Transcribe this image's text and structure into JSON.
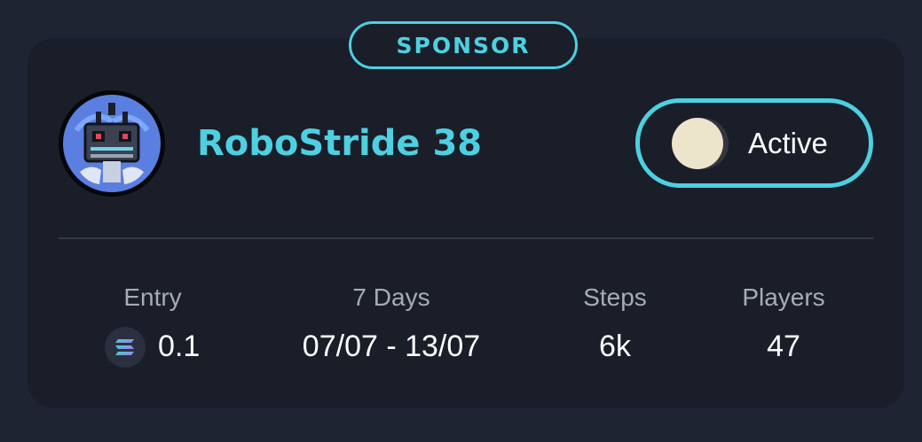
{
  "badge": {
    "label": "SPONSOR"
  },
  "challenge": {
    "title": "RoboStride 38",
    "avatar_icon": "robot-avatar-icon"
  },
  "toggle": {
    "label": "Active",
    "state": "on"
  },
  "stats": {
    "entry": {
      "label": "Entry",
      "value": "0.1",
      "currency_icon": "solana-icon"
    },
    "duration": {
      "label": "7 Days",
      "value": "07/07 - 13/07"
    },
    "steps": {
      "label": "Steps",
      "value": "6k"
    },
    "players": {
      "label": "Players",
      "value": "47"
    }
  },
  "colors": {
    "accent": "#4dd0e1",
    "card_background": "#191e29",
    "page_background": "#1f2432",
    "label_text": "#a6acb7",
    "value_text": "#ffffff"
  }
}
